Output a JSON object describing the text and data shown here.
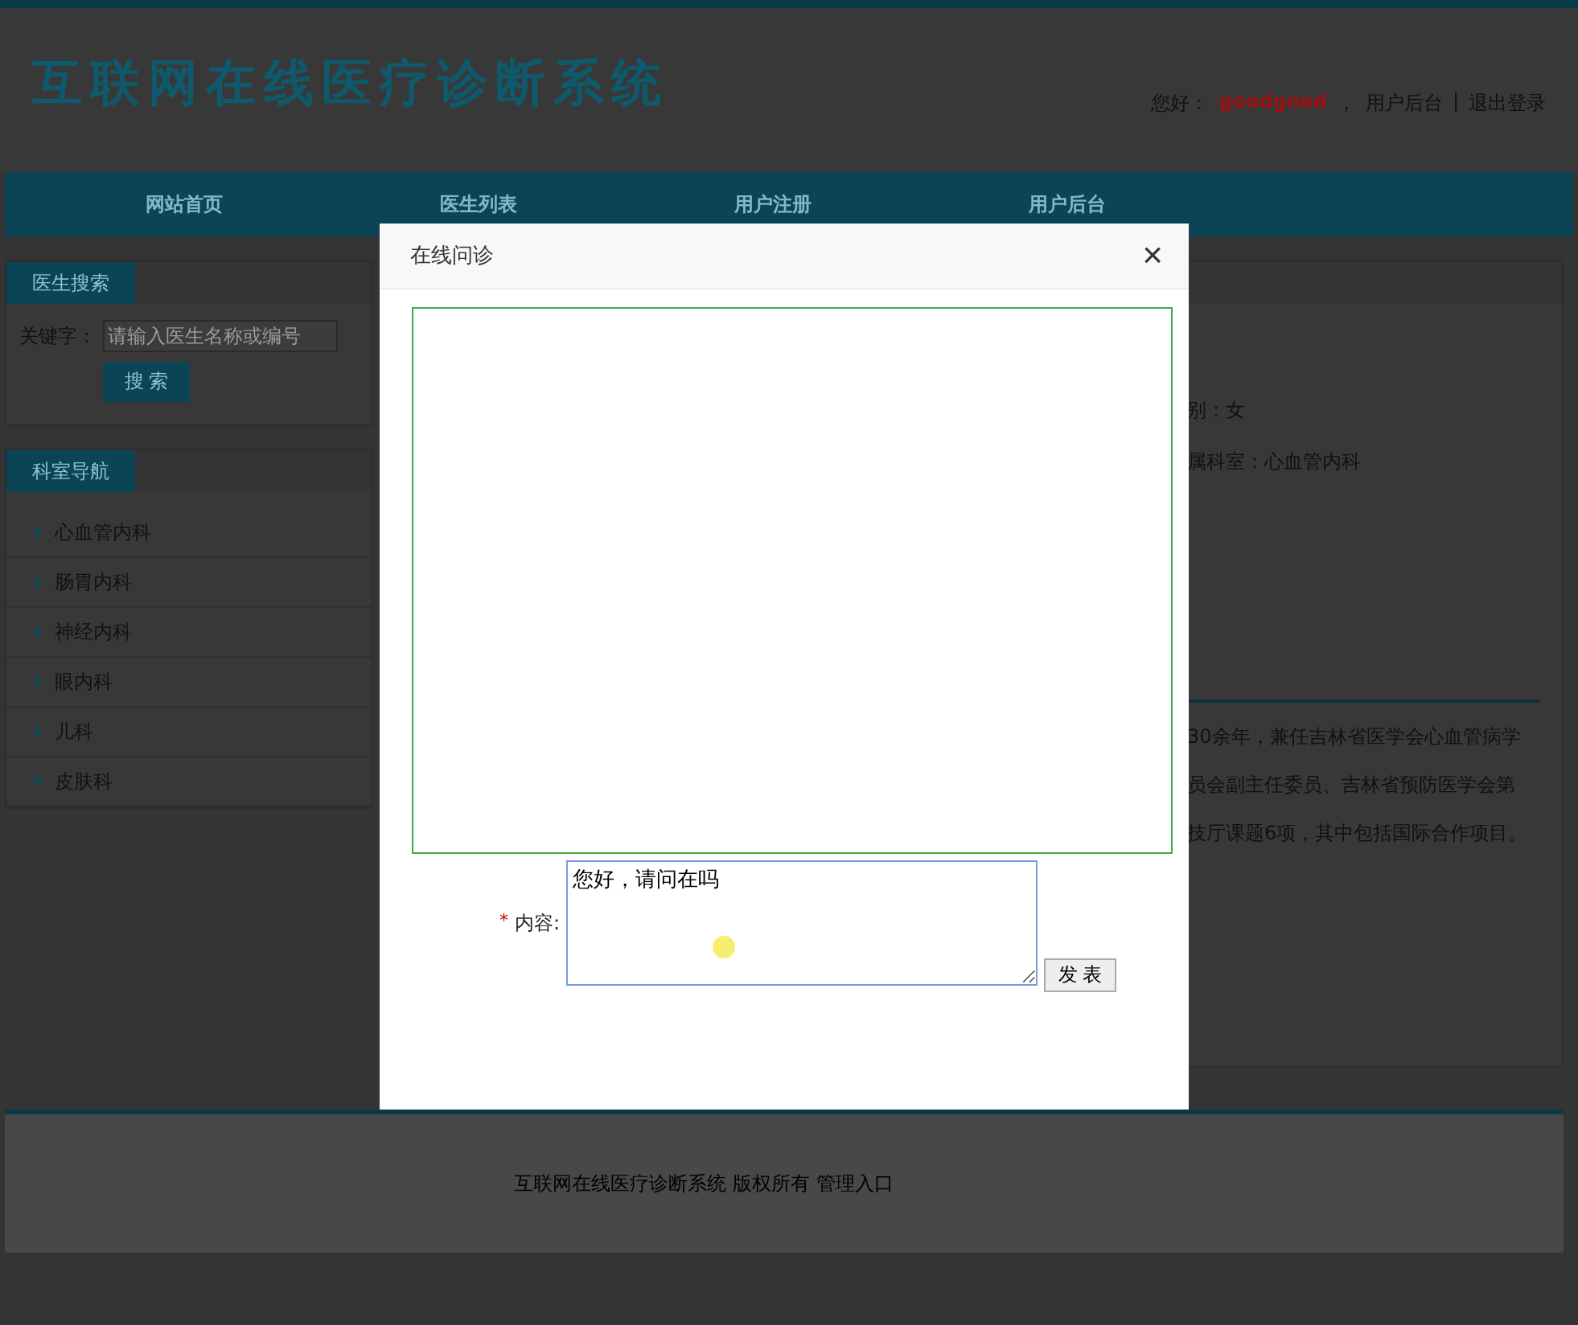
{
  "header": {
    "logo": "互联网在线医疗诊断系统",
    "user_bar": [
      {
        "kind": "label",
        "text": "您好："
      },
      {
        "kind": "user",
        "text": "goodgood"
      },
      {
        "kind": "label",
        "text": "，"
      },
      {
        "kind": "link",
        "text": "用户后台"
      },
      {
        "kind": "label",
        "text": "|"
      },
      {
        "kind": "link",
        "text": "退出登录"
      }
    ]
  },
  "nav": [
    "网站首页",
    "医生列表",
    "用户注册",
    "用户后台"
  ],
  "search_panel": {
    "title": "医生搜索",
    "keyword_label": "关键字：",
    "placeholder": "请输入医生名称或编号",
    "button": "搜 索"
  },
  "department_panel": {
    "title": "科室导航",
    "items": [
      "心血管内科",
      "肠胃内科",
      "神经内科",
      "眼内科",
      "儿科",
      "皮肤科"
    ]
  },
  "doctor_info": {
    "fields": [
      "别：女",
      "属科室：心血管内科"
    ],
    "intro_lines": [
      "30余年，兼任吉林省医学会心血管病学",
      "员会副主任委员、吉林省预防医学会第",
      "技厅课题6项，其中包括国际合作项目。"
    ]
  },
  "footer": {
    "text": "互联网在线医疗诊断系统 版权所有",
    "link": "管理入口"
  },
  "dialog": {
    "title": "在线问诊",
    "close": "×",
    "content_label": "内容:",
    "required_mark": "*",
    "content_value": "您好，请问在吗",
    "submit": "发 表"
  }
}
